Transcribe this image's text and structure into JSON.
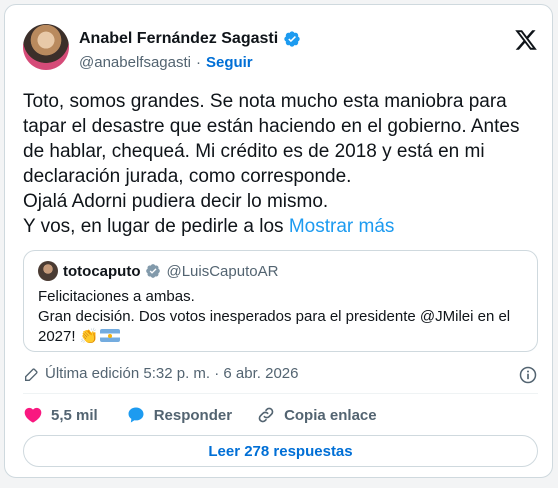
{
  "author": {
    "name": "Anabel Fernández Sagasti",
    "handle": "@anabelfsagasti",
    "follow_label": "Seguir",
    "verified_color": "#1d9bf0"
  },
  "brand_icon": "x-logo-icon",
  "tweet": {
    "text": "Toto, somos grandes. Se nota mucho esta maniobra para tapar el desastre que están haciendo en el gobierno. Antes de hablar, chequeá. Mi crédito es de 2018 y está en mi declaración jurada, como corresponde.\nOjalá Adorni pudiera decir lo mismo.\nY vos, en lugar de pedirle a los ",
    "show_more_label": "Mostrar más"
  },
  "quoted": {
    "name": "totocaputo",
    "handle": "@LuisCaputoAR",
    "text": "Felicitaciones a ambas.\nGran decisión. Dos votos inesperados para el presidente @JMilei en el 2027! ",
    "emojis": [
      "clapping-hands-icon",
      "argentina-flag-icon"
    ]
  },
  "meta": {
    "edited_label": "Última edición 5:32 p. m. · 6 abr. 2026"
  },
  "actions": {
    "likes": "5,5 mil",
    "reply_label": "Responder",
    "copy_link_label": "Copia enlace"
  },
  "read_replies_label": "Leer 278 respuestas",
  "colors": {
    "accent": "#1d9bf0",
    "link": "#006fd6",
    "like": "#f91880",
    "muted": "#536471"
  }
}
